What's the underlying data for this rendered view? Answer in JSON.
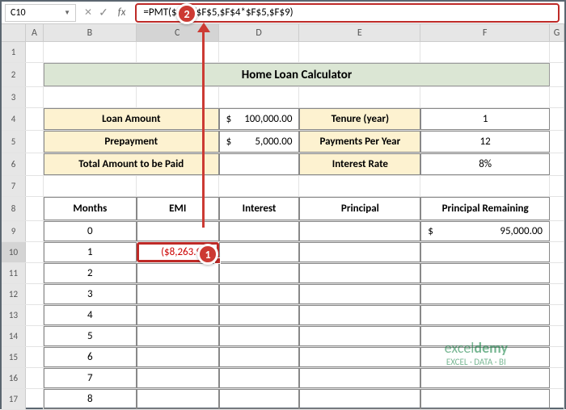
{
  "formula_bar": {
    "cell_ref": "C10",
    "fx": "fx",
    "formula": "=PMT($F$6/$F$5,$F$4*$F$5,$F$9)"
  },
  "cols": [
    "A",
    "B",
    "C",
    "D",
    "E",
    "F",
    "G"
  ],
  "rows": [
    "1",
    "2",
    "3",
    "4",
    "5",
    "6",
    "7",
    "8",
    "9",
    "10",
    "11",
    "12",
    "13",
    "14",
    "15",
    "16",
    "17"
  ],
  "title": "Home Loan Calculator",
  "labels": {
    "loan_amount": "Loan Amount",
    "prepayment": "Prepayment",
    "total_paid": "Total Amount to be Paid",
    "tenure": "Tenure (year)",
    "ppy": "Payments Per Year",
    "rate": "Interest Rate"
  },
  "vals": {
    "loan_amount": "100,000.00",
    "prepayment": "5,000.00",
    "tenure": "1",
    "ppy": "12",
    "rate": "8%",
    "dollar": "$"
  },
  "headers": {
    "months": "Months",
    "emi": "EMI",
    "interest": "Interest",
    "principal": "Principal",
    "remain": "Principal Remaining"
  },
  "data": {
    "months": [
      "0",
      "1",
      "2",
      "3",
      "4",
      "5",
      "6",
      "7",
      "8"
    ],
    "emi_c10": "($8,263.90)",
    "remain_f9": "95,000.00"
  },
  "callouts": {
    "one": "1",
    "two": "2"
  },
  "watermark": {
    "brand_a": "excel",
    "brand_b": "demy",
    "tag": "EXCEL · DATA · BI"
  },
  "chart_data": {
    "type": "table",
    "title": "Home Loan Calculator",
    "inputs": {
      "Loan Amount": 100000.0,
      "Prepayment": 5000.0,
      "Tenure (year)": 1,
      "Payments Per Year": 12,
      "Interest Rate": 0.08
    },
    "schedule_headers": [
      "Months",
      "EMI",
      "Interest",
      "Principal",
      "Principal Remaining"
    ],
    "schedule_rows": [
      {
        "Months": 0,
        "Principal Remaining": 95000.0
      },
      {
        "Months": 1,
        "EMI": -8263.9
      }
    ],
    "formula_cell": {
      "cell": "C10",
      "formula": "=PMT($F$6/$F$5,$F$4*$F$5,$F$9)"
    }
  }
}
